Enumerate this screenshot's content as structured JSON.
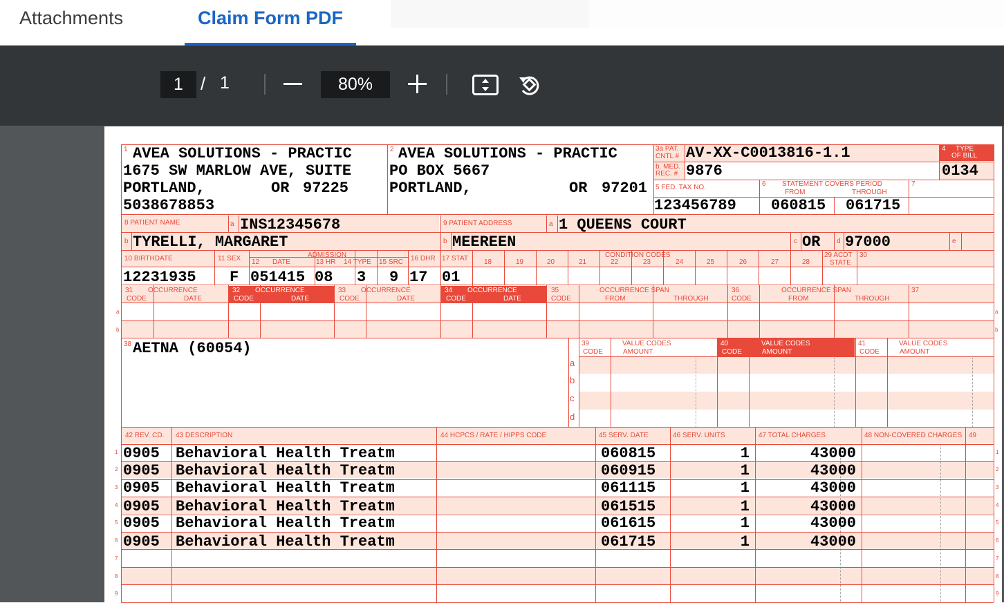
{
  "tabs": {
    "attachments": "Attachments",
    "claim_form": "Claim Form PDF"
  },
  "toolbar": {
    "page": "1",
    "slash": "/",
    "total": "1",
    "zoom": "80%"
  },
  "icons": {
    "minus": "zoom-out-icon",
    "plus": "zoom-in-icon",
    "fit": "fit-page-icon",
    "rotate": "rotate-icon"
  },
  "colors": {
    "accent": "#1a66c4",
    "form_red": "#e8493a",
    "form_pink": "#fde5dc",
    "toolbar": "#323639",
    "viewer": "#525659"
  },
  "form": {
    "labels": {
      "f1": "1",
      "f2": "2",
      "f3a": "3a PAT.",
      "f3a2": "CNTL #",
      "f3b": "b. MED.",
      "f3b2": "REC. #",
      "f4": "4",
      "f4b": "TYPE",
      "f4c": "OF BILL",
      "f5": "5 FED. TAX NO.",
      "f6": "6",
      "f6b": "STATEMENT  COVERS PERIOD",
      "f6from": "FROM",
      "f6thru": "THROUGH",
      "f7": "7",
      "f8": "8 PATIENT  NAME",
      "fa": "a",
      "f9": "9 PATIENT  ADDRESS",
      "fb": "b",
      "fc": "c",
      "fd": "d",
      "fe": "e",
      "f10": "10 BIRTHDATE",
      "f11": "11 SEX",
      "f12": "12",
      "f12d": "DATE",
      "fadm": "ADMISSION",
      "f13": "13 HR",
      "f14": "14 TYPE",
      "f15": "15 SRC",
      "f16": "16 DHR",
      "f17": "17 STAT",
      "fcond": "CONDITION CODES",
      "c18": "18",
      "c19": "19",
      "c20": "20",
      "c21": "21",
      "c22": "22",
      "c23": "23",
      "c24": "24",
      "c25": "25",
      "c26": "26",
      "c27": "27",
      "c28": "28",
      "f29": "29 ACDT",
      "f29b": "STATE",
      "f30": "30",
      "f31": "31",
      "f32": "32",
      "f33": "33",
      "f34": "34",
      "focc": "OCCURRENCE",
      "fcode": "CODE",
      "fdate": "DATE",
      "f35": "35",
      "f36": "36",
      "fspan": "OCCURRENCE SPAN",
      "ffrom": "FROM",
      "fthrough": "THROUGH",
      "f37": "37",
      "f38": "38",
      "f39": "39",
      "f40": "40",
      "f41": "41",
      "fvc": "VALUE CODES",
      "famt": "AMOUNT",
      "va": "a",
      "vb": "b",
      "vc": "c",
      "vd": "d",
      "f42": "42 REV. CD.",
      "f43": "43 DESCRIPTION",
      "f44": "44 HCPCS / RATE / HIPPS CODE",
      "f45": "45 SERV. DATE",
      "f46": "46 SERV. UNITS",
      "f47": "47 TOTAL CHARGES",
      "f48": "48 NON-COVERED CHARGES",
      "f49": "49"
    },
    "row_nums": [
      "1",
      "2",
      "3",
      "4",
      "5",
      "6",
      "7",
      "8",
      "9"
    ],
    "provider": {
      "name": "AVEA SOLUTIONS - PRACTIC",
      "address": "1675 SW MARLOW AVE, SUITE",
      "city": "PORTLAND,",
      "state": "OR",
      "zip": "97225",
      "phone": "5038678853"
    },
    "pay_to": {
      "name": "AVEA SOLUTIONS - PRACTIC",
      "address": "PO BOX 5667",
      "city": "PORTLAND,",
      "state": "OR",
      "zip": "97201"
    },
    "pat_cntl": "AV-XX-C0013816-1.1",
    "med_rec": "9876",
    "type_of_bill": "0134",
    "fed_tax": "123456789",
    "from": "060815",
    "through": "061715",
    "patient_id": "INS12345678",
    "patient_name": "TYRELLI, MARGARET",
    "patient_address": "1 QUEENS COURT",
    "patient_city": "MEEREEN",
    "patient_state": "OR",
    "patient_zip": "97000",
    "birthdate": "12231935",
    "sex": "F",
    "adm_date": "051415",
    "adm_hr": "08",
    "adm_type": "3",
    "adm_src": "9",
    "dhr": "17",
    "stat": "01",
    "payer": "AETNA (60054)",
    "lines": [
      {
        "rev": "0905",
        "desc": "Behavioral Health Treatm",
        "date": "060815",
        "units": "1",
        "charges": "43000"
      },
      {
        "rev": "0905",
        "desc": "Behavioral Health Treatm",
        "date": "060915",
        "units": "1",
        "charges": "43000"
      },
      {
        "rev": "0905",
        "desc": "Behavioral Health Treatm",
        "date": "061115",
        "units": "1",
        "charges": "43000"
      },
      {
        "rev": "0905",
        "desc": "Behavioral Health Treatm",
        "date": "061515",
        "units": "1",
        "charges": "43000"
      },
      {
        "rev": "0905",
        "desc": "Behavioral Health Treatm",
        "date": "061615",
        "units": "1",
        "charges": "43000"
      },
      {
        "rev": "0905",
        "desc": "Behavioral Health Treatm",
        "date": "061715",
        "units": "1",
        "charges": "43000"
      }
    ]
  }
}
